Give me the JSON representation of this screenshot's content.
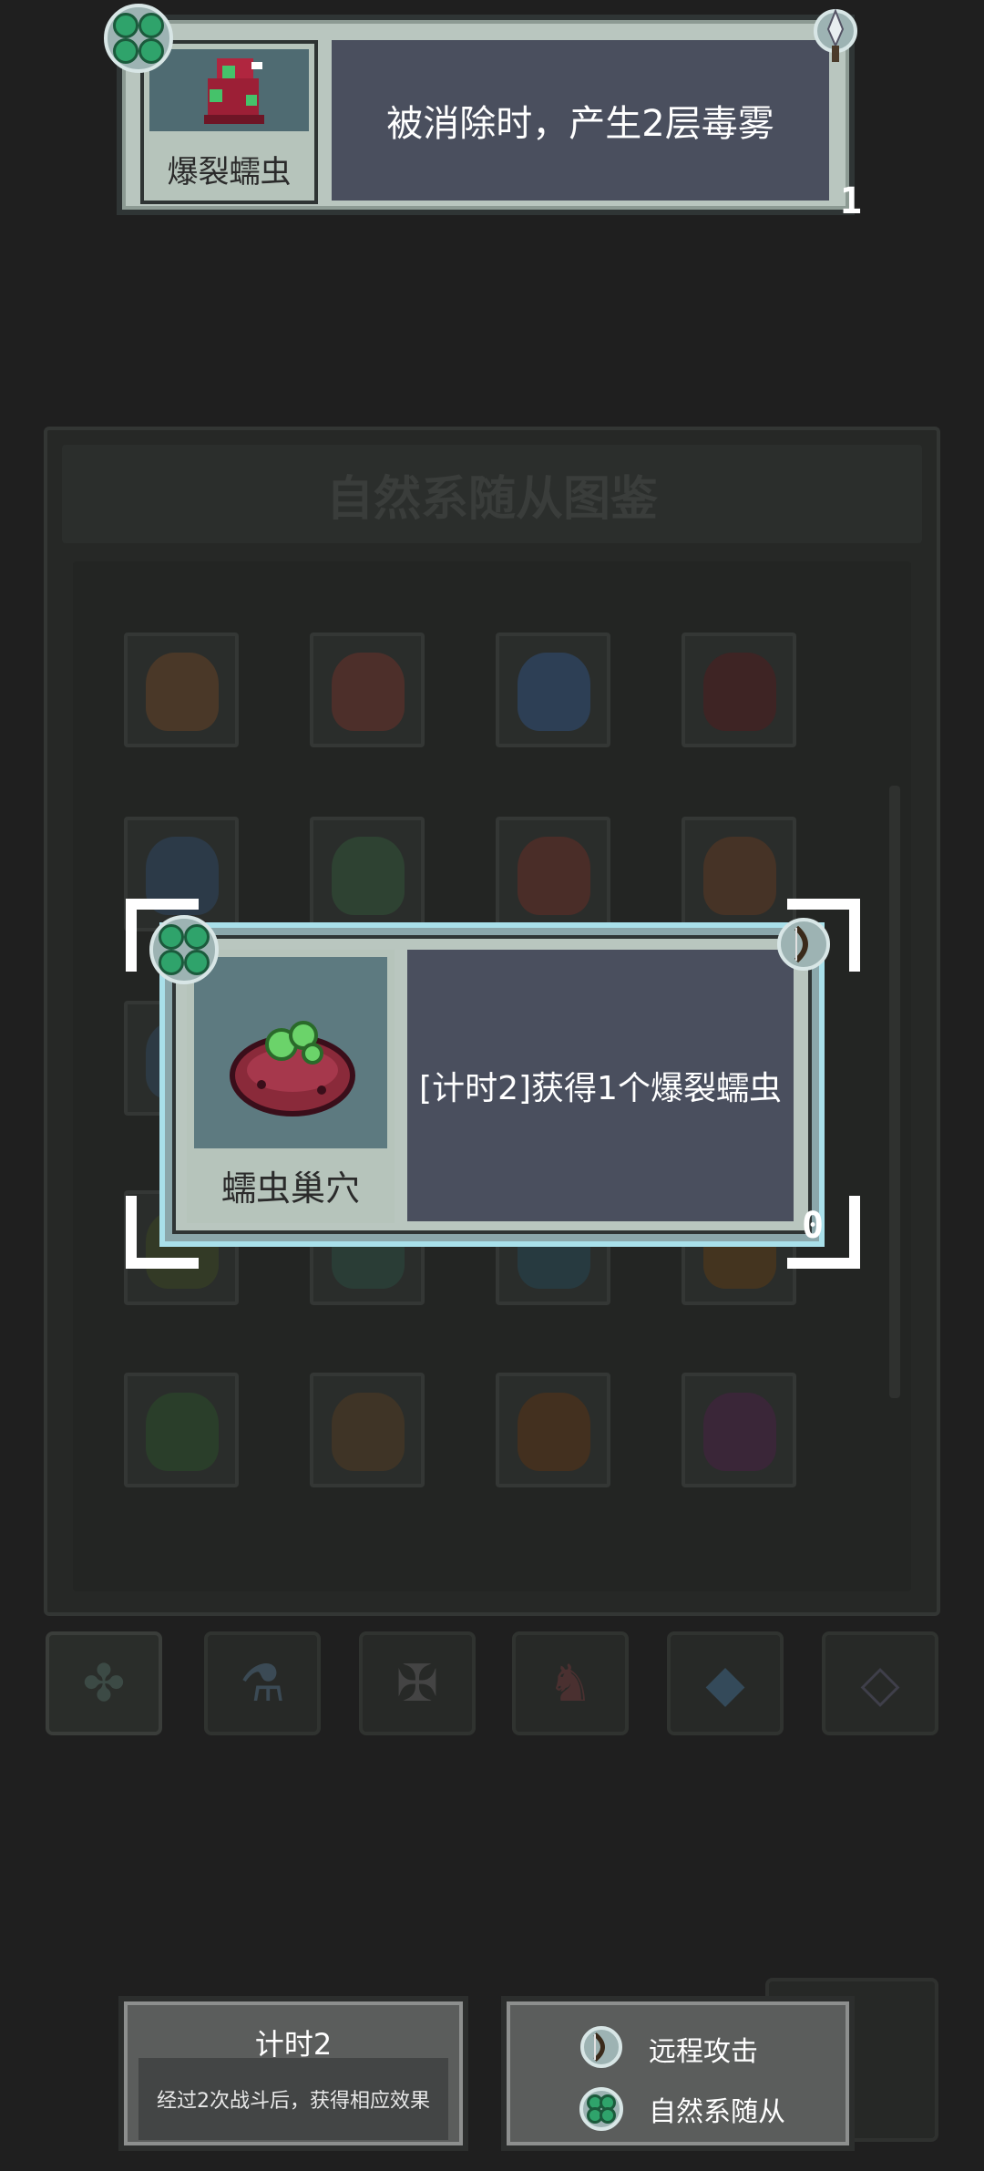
{
  "top_card": {
    "name": "爆裂蠕虫",
    "description": "被消除时，产生2层毒雾",
    "count": "1",
    "icons": [
      "clover-icon",
      "sword-icon"
    ]
  },
  "encyclopedia": {
    "title": "自然系随从图鉴",
    "tabs": [
      "nature-clover-icon",
      "potion-icon",
      "rune-icon",
      "fox-icon",
      "diamond-icon",
      "gem-icon"
    ]
  },
  "center_card": {
    "name": "蠕虫巢穴",
    "description": "[计时2]获得1个爆裂蠕虫",
    "count": "0",
    "icons": [
      "clover-icon",
      "ranged-bow-icon"
    ]
  },
  "keywords": {
    "timer": {
      "title": "计时2",
      "body": "经过2次战斗后，获得相应效果"
    },
    "tags": [
      {
        "icon": "ranged-bow-icon",
        "label": "远程攻击"
      },
      {
        "icon": "clover-icon",
        "label": "自然系随从"
      }
    ]
  },
  "colors": {
    "background": "#1f1f1f",
    "card_frame": "#b9c6bf",
    "desc_panel": "#4a4f5e",
    "highlight": "#a9e0ea",
    "nature_green": "#2fa36b"
  }
}
